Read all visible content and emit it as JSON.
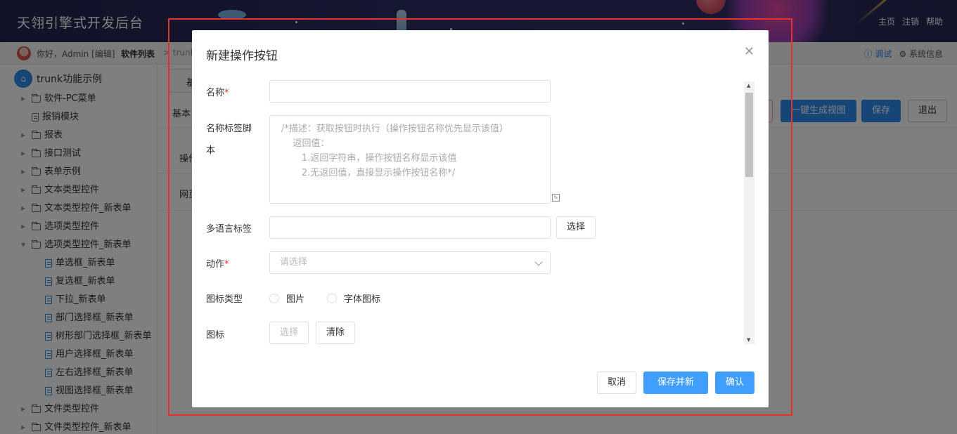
{
  "header": {
    "title": "天翎引擎式开发后台",
    "links": [
      "主页",
      "注销",
      "帮助"
    ]
  },
  "subbar": {
    "greeting": "你好，Admin [编辑]",
    "crumb": "软件列表",
    "crumb_next": "trunk",
    "debug": "调试",
    "system_info": "系统信息"
  },
  "sidebar": {
    "root": "trunk功能示例",
    "items": [
      {
        "label": "软件-PC菜单",
        "type": "folder",
        "expanded": false
      },
      {
        "label": "报销模块",
        "type": "doc"
      },
      {
        "label": "报表",
        "type": "folder",
        "expanded": false
      },
      {
        "label": "接口测试",
        "type": "folder",
        "expanded": false
      },
      {
        "label": "表单示例",
        "type": "folder",
        "expanded": false
      },
      {
        "label": "文本类型控件",
        "type": "folder",
        "expanded": false
      },
      {
        "label": "文本类型控件_新表单",
        "type": "folder",
        "expanded": false
      },
      {
        "label": "选项类型控件",
        "type": "folder",
        "expanded": false
      },
      {
        "label": "选项类型控件_新表单",
        "type": "folder",
        "expanded": true
      },
      {
        "label": "单选框_新表单",
        "type": "child"
      },
      {
        "label": "复选框_新表单",
        "type": "child"
      },
      {
        "label": "下拉_新表单",
        "type": "child"
      },
      {
        "label": "部门选择框_新表单",
        "type": "child"
      },
      {
        "label": "树形部门选择框_新表单",
        "type": "child"
      },
      {
        "label": "用户选择框_新表单",
        "type": "child"
      },
      {
        "label": "左右选择框_新表单",
        "type": "child"
      },
      {
        "label": "视图选择框_新表单",
        "type": "child"
      },
      {
        "label": "文件类型控件",
        "type": "folder",
        "expanded": false
      },
      {
        "label": "文件类型控件_新表单",
        "type": "folder",
        "expanded": false
      }
    ]
  },
  "content": {
    "tab": "基",
    "basic": "基本",
    "op": "操作",
    "web": "网页",
    "gen_view": "一键生成视图",
    "save": "保存",
    "exit": "退出"
  },
  "modal": {
    "title": "新建操作按钮",
    "fields": {
      "name_label": "名称",
      "name_value": "",
      "script_label_1": "名称标签脚",
      "script_label_2": "本",
      "script_placeholder": "/*描述：获取按钮时执行（操作按钮名称优先显示该值）\n    返回值：\n       1.返回字符串，操作按钮名称显示该值\n       2.无返回值，直接显示操作按钮名称*/",
      "i18n_label": "多语言标签",
      "i18n_value": "",
      "i18n_select": "选择",
      "action_label": "动作",
      "action_placeholder": "请选择",
      "icon_type_label": "图标类型",
      "icon_type_options": [
        "图片",
        "字体图标"
      ],
      "icon_label": "图标",
      "icon_select": "选择",
      "icon_clear": "清除"
    },
    "buttons": {
      "cancel": "取消",
      "save_new": "保存并新建",
      "confirm": "确认"
    }
  }
}
